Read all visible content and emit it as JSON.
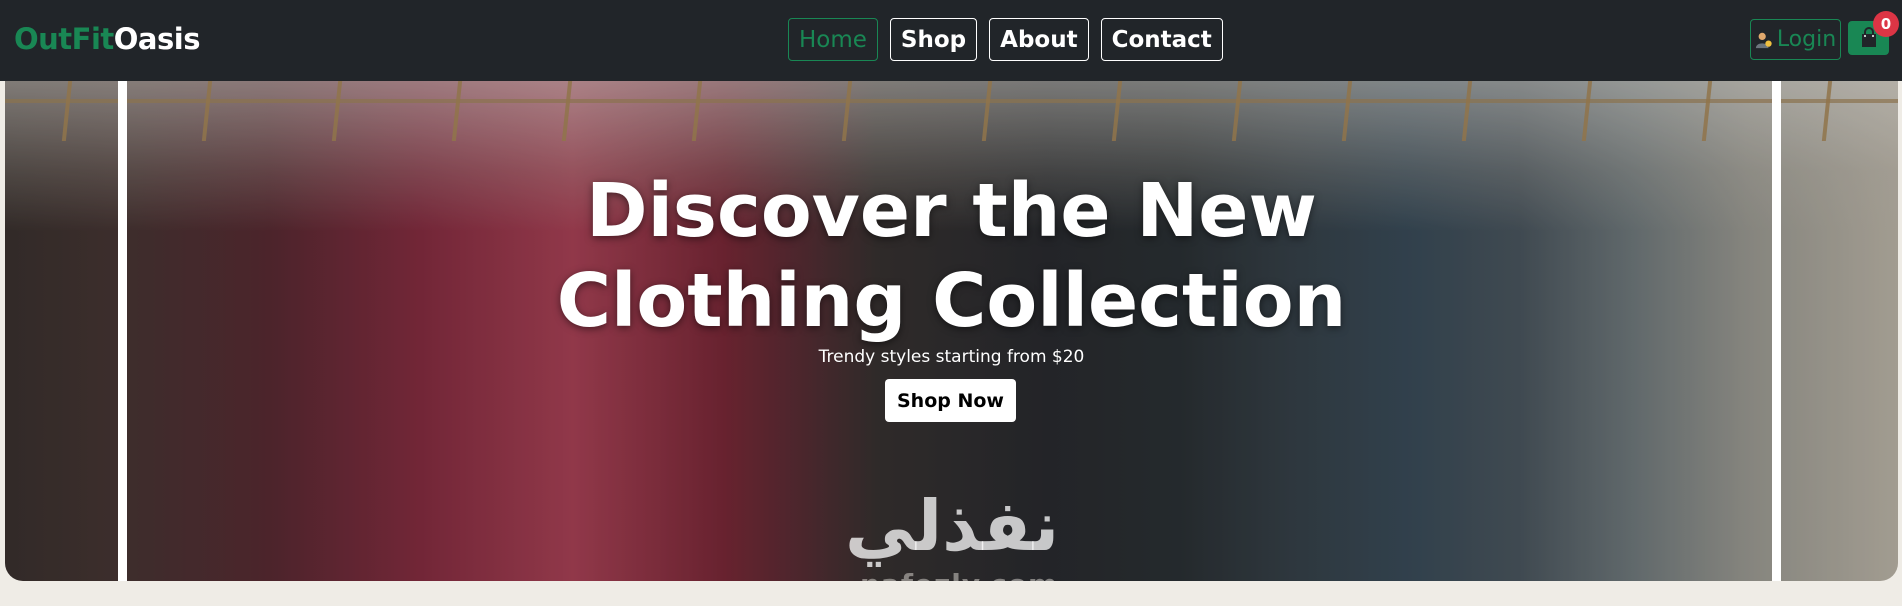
{
  "brand": {
    "part1": "OutFit",
    "part2": "Oasis"
  },
  "nav": {
    "items": [
      {
        "label": "Home",
        "active": true
      },
      {
        "label": "Shop",
        "active": false
      },
      {
        "label": "About",
        "active": false
      },
      {
        "label": "Contact",
        "active": false
      }
    ]
  },
  "header": {
    "login_label": "Login",
    "login_icon": "user-icon",
    "cart_icon": "shopping-bag-icon",
    "cart_count": "0"
  },
  "hero": {
    "title_line1": "Discover the New",
    "title_line2": "Clothing Collection",
    "subtitle": "Trendy styles starting from $20",
    "cta_label": "Shop Now"
  },
  "watermark": {
    "arabic": "نفذلي",
    "latin": "nafezly.com"
  },
  "colors": {
    "navbar_bg": "#212529",
    "accent": "#198754",
    "badge": "#dc3545"
  }
}
